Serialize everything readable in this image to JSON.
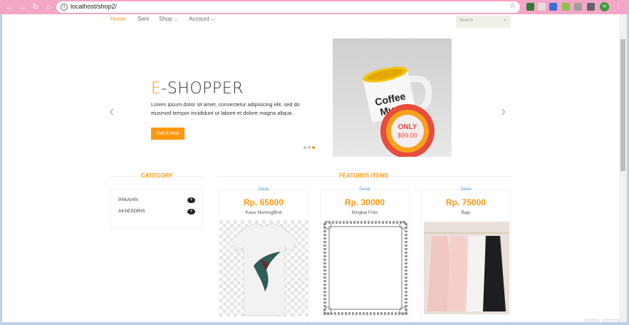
{
  "browser": {
    "url": "localhost/shop2/",
    "profile_initial": "H",
    "icons": [
      "back-arrow-icon",
      "forward-arrow-icon",
      "reload-icon",
      "home-icon",
      "info-icon",
      "star-icon",
      "extensions-icon",
      "menu-icon"
    ]
  },
  "nav": {
    "items": [
      {
        "label": "Home"
      },
      {
        "label": "Seni"
      },
      {
        "label": "Shop ⌵"
      },
      {
        "label": "Account ⌵"
      }
    ],
    "search_placeholder": "Search"
  },
  "slider": {
    "brand_first": "E",
    "brand_rest": "-SHOPPER",
    "description": "Lorem ipsum dolor sit amet, consectetur adipisicing elit, sed do eiusmod tempor incididunt ut labore et dolore magna aliqua.",
    "button": "Get it now",
    "mug_text_1": "Coffee",
    "mug_text_2": "Mug",
    "badge_top": "ONLY",
    "badge_price": "$99.00",
    "active_dot": 3,
    "dot_count": 3
  },
  "category": {
    "title": "CATEGORY",
    "items": [
      {
        "label": "PAKAIAN"
      },
      {
        "label": "AKSESORIS"
      }
    ]
  },
  "features": {
    "title": "FEATURES ITEMS",
    "products": [
      {
        "detail": "Detail",
        "price": "Rp. 65000",
        "name": "Kaos HumingBird"
      },
      {
        "detail": "Detail",
        "price": "Rp. 30000",
        "name": "Bingkai Foto"
      },
      {
        "detail": "Detail",
        "price": "Rp. 75000",
        "name": "Baju"
      }
    ]
  },
  "colors": {
    "accent": "#fe980f",
    "chrome": "#f4a6c6"
  }
}
